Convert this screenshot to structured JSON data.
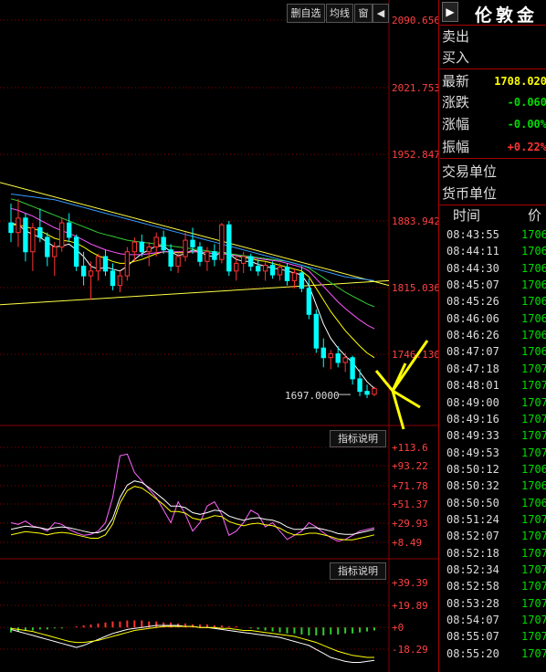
{
  "toolbar": {
    "delete_label": "删自选",
    "ma_label": "均线",
    "window_label": "窗",
    "back_label": "◀"
  },
  "price_axis": [
    "2090.656",
    "2021.753",
    "1952.847",
    "1883.942",
    "1815.036",
    "1746.130"
  ],
  "price_line_label": "1697.0000",
  "indicator1": {
    "button": "指标说明",
    "ticks": [
      "+113.6",
      "+93.22",
      "+71.78",
      "+51.37",
      "+29.93",
      "+8.49"
    ]
  },
  "indicator2": {
    "button": "指标说明",
    "ticks": [
      "+39.39",
      "+19.89",
      "+0",
      "-18.29"
    ]
  },
  "side": {
    "title": "伦敦金",
    "collapse_icon": "▶",
    "sell_label": "卖出",
    "buy_label": "买入",
    "latest_label": "最新",
    "latest_value": "1708.020",
    "change_label": "涨跌",
    "change_value": "-0.060",
    "pct_label": "涨幅",
    "pct_value": "-0.00%",
    "amp_label": "振幅",
    "amp_value": "+0.22%",
    "unit_label": "交易单位",
    "currency_label": "货币单位",
    "time_header": "时间",
    "price_header": "价",
    "ticks": [
      {
        "time": "08:43:55",
        "price": "1706."
      },
      {
        "time": "08:44:11",
        "price": "1706."
      },
      {
        "time": "08:44:30",
        "price": "1706."
      },
      {
        "time": "08:45:07",
        "price": "1706."
      },
      {
        "time": "08:45:26",
        "price": "1706."
      },
      {
        "time": "08:46:06",
        "price": "1706."
      },
      {
        "time": "08:46:26",
        "price": "1706."
      },
      {
        "time": "08:47:07",
        "price": "1706."
      },
      {
        "time": "08:47:18",
        "price": "1707."
      },
      {
        "time": "08:48:01",
        "price": "1707."
      },
      {
        "time": "08:49:00",
        "price": "1707."
      },
      {
        "time": "08:49:16",
        "price": "1707."
      },
      {
        "time": "08:49:33",
        "price": "1707."
      },
      {
        "time": "08:49:53",
        "price": "1707."
      },
      {
        "time": "08:50:12",
        "price": "1706."
      },
      {
        "time": "08:50:32",
        "price": "1706."
      },
      {
        "time": "08:50:50",
        "price": "1706."
      },
      {
        "time": "08:51:24",
        "price": "1707."
      },
      {
        "time": "08:52:07",
        "price": "1707."
      },
      {
        "time": "08:52:18",
        "price": "1707."
      },
      {
        "time": "08:52:34",
        "price": "1707."
      },
      {
        "time": "08:52:58",
        "price": "1707."
      },
      {
        "time": "08:53:28",
        "price": "1707."
      },
      {
        "time": "08:54:07",
        "price": "1707."
      },
      {
        "time": "08:55:07",
        "price": "1707."
      },
      {
        "time": "08:55:20",
        "price": "1707."
      }
    ]
  },
  "colors": {
    "up": "#ff3333",
    "down": "#00ffff",
    "grid": "#8a0000",
    "axis_text": "#ff4040",
    "accent": "#ffff00"
  },
  "chart_data": {
    "type": "candlestick",
    "candles": [
      [
        1880,
        1900,
        1860,
        1870
      ],
      [
        1870,
        1905,
        1855,
        1885
      ],
      [
        1885,
        1890,
        1840,
        1850
      ],
      [
        1850,
        1880,
        1830,
        1875
      ],
      [
        1875,
        1895,
        1860,
        1865
      ],
      [
        1865,
        1870,
        1835,
        1845
      ],
      [
        1845,
        1860,
        1825,
        1855
      ],
      [
        1855,
        1885,
        1850,
        1880
      ],
      [
        1880,
        1890,
        1860,
        1865
      ],
      [
        1865,
        1868,
        1830,
        1835
      ],
      [
        1835,
        1850,
        1815,
        1825
      ],
      [
        1825,
        1840,
        1800,
        1830
      ],
      [
        1830,
        1848,
        1820,
        1845
      ],
      [
        1845,
        1852,
        1825,
        1830
      ],
      [
        1830,
        1838,
        1810,
        1815
      ],
      [
        1815,
        1830,
        1808,
        1825
      ],
      [
        1825,
        1855,
        1820,
        1850
      ],
      [
        1850,
        1865,
        1840,
        1860
      ],
      [
        1860,
        1868,
        1845,
        1850
      ],
      [
        1850,
        1860,
        1835,
        1855
      ],
      [
        1855,
        1870,
        1845,
        1865
      ],
      [
        1865,
        1872,
        1848,
        1852
      ],
      [
        1852,
        1858,
        1830,
        1835
      ],
      [
        1835,
        1848,
        1828,
        1845
      ],
      [
        1845,
        1870,
        1840,
        1862
      ],
      [
        1862,
        1875,
        1848,
        1855
      ],
      [
        1855,
        1860,
        1835,
        1840
      ],
      [
        1840,
        1855,
        1830,
        1850
      ],
      [
        1850,
        1858,
        1835,
        1842
      ],
      [
        1842,
        1880,
        1838,
        1878
      ],
      [
        1878,
        1882,
        1825,
        1830
      ],
      [
        1830,
        1845,
        1820,
        1838
      ],
      [
        1838,
        1850,
        1828,
        1845
      ],
      [
        1845,
        1848,
        1830,
        1835
      ],
      [
        1835,
        1842,
        1825,
        1830
      ],
      [
        1830,
        1840,
        1820,
        1836
      ],
      [
        1836,
        1840,
        1822,
        1826
      ],
      [
        1826,
        1838,
        1820,
        1834
      ],
      [
        1834,
        1838,
        1815,
        1820
      ],
      [
        1820,
        1832,
        1812,
        1828
      ],
      [
        1828,
        1835,
        1808,
        1812
      ],
      [
        1812,
        1822,
        1780,
        1785
      ],
      [
        1785,
        1790,
        1745,
        1750
      ],
      [
        1750,
        1760,
        1730,
        1740
      ],
      [
        1740,
        1748,
        1728,
        1744
      ],
      [
        1744,
        1752,
        1730,
        1735
      ],
      [
        1735,
        1745,
        1725,
        1740
      ],
      [
        1740,
        1742,
        1712,
        1718
      ],
      [
        1718,
        1728,
        1700,
        1705
      ],
      [
        1705,
        1712,
        1698,
        1702
      ],
      [
        1702,
        1710,
        1700,
        1708
      ]
    ],
    "ma_series": [
      {
        "color": "#ffffff",
        "values": [
          1880,
          1878,
          1872,
          1868,
          1865,
          1860,
          1855,
          1856,
          1858,
          1852,
          1845,
          1835,
          1832,
          1834,
          1832,
          1830,
          1835,
          1842,
          1848,
          1852,
          1856,
          1856,
          1850,
          1846,
          1848,
          1852,
          1850,
          1846,
          1845,
          1850,
          1848,
          1842,
          1840,
          1840,
          1837,
          1835,
          1833,
          1832,
          1830,
          1828,
          1826,
          1815,
          1795,
          1775,
          1760,
          1750,
          1742,
          1735,
          1725,
          1715,
          1708
        ]
      },
      {
        "color": "#ffff00",
        "values": [
          1878,
          1878,
          1876,
          1874,
          1872,
          1868,
          1864,
          1862,
          1861,
          1859,
          1855,
          1850,
          1846,
          1843,
          1840,
          1838,
          1838,
          1840,
          1842,
          1845,
          1848,
          1850,
          1850,
          1849,
          1849,
          1850,
          1850,
          1849,
          1848,
          1848,
          1848,
          1846,
          1844,
          1843,
          1841,
          1840,
          1838,
          1836,
          1834,
          1832,
          1830,
          1824,
          1812,
          1800,
          1788,
          1778,
          1768,
          1760,
          1752,
          1745,
          1740
        ]
      },
      {
        "color": "#ff55ff",
        "values": [
          1895,
          1893,
          1890,
          1887,
          1883,
          1879,
          1875,
          1872,
          1869,
          1866,
          1862,
          1858,
          1855,
          1852,
          1850,
          1848,
          1847,
          1847,
          1847,
          1848,
          1849,
          1850,
          1850,
          1850,
          1850,
          1850,
          1850,
          1849,
          1848,
          1848,
          1847,
          1846,
          1845,
          1844,
          1843,
          1842,
          1841,
          1840,
          1838,
          1836,
          1834,
          1830,
          1822,
          1814,
          1806,
          1798,
          1791,
          1785,
          1779,
          1774,
          1770
        ]
      },
      {
        "color": "#33cc33",
        "values": [
          1905,
          1903,
          1900,
          1897,
          1894,
          1891,
          1888,
          1885,
          1882,
          1879,
          1876,
          1873,
          1870,
          1868,
          1866,
          1864,
          1862,
          1861,
          1860,
          1859,
          1858,
          1857,
          1856,
          1855,
          1854,
          1853,
          1852,
          1851,
          1850,
          1849,
          1848,
          1847,
          1846,
          1845,
          1844,
          1843,
          1842,
          1841,
          1840,
          1838,
          1836,
          1833,
          1828,
          1823,
          1818,
          1813,
          1808,
          1804,
          1800,
          1796,
          1793
        ]
      },
      {
        "color": "#3399ff",
        "values": [
          1910,
          1909,
          1908,
          1907,
          1906,
          1905,
          1904,
          1902,
          1900,
          1898,
          1896,
          1894,
          1892,
          1890,
          1888,
          1886,
          1884,
          1882,
          1880,
          1878,
          1876,
          1874,
          1872,
          1870,
          1868,
          1866,
          1864,
          1862,
          1860,
          1858,
          1856,
          1854,
          1852,
          1850,
          1848,
          1846,
          1844,
          1842,
          1840,
          1838,
          1836,
          1834,
          1832,
          1830,
          1828,
          1826,
          1824,
          1823,
          1822,
          1821,
          1820
        ]
      }
    ],
    "trend_lines": [
      {
        "color": "#ffff44",
        "from": [
          0,
          1922
        ],
        "to": [
          50,
          1815
        ]
      },
      {
        "color": "#ffff44",
        "from": [
          0,
          1795
        ],
        "to": [
          50,
          1820
        ]
      }
    ],
    "indicator1": {
      "fast": [
        30,
        28,
        32,
        26,
        24,
        20,
        30,
        28,
        22,
        18,
        15,
        16,
        20,
        30,
        60,
        110,
        112,
        90,
        80,
        70,
        60,
        45,
        30,
        55,
        40,
        20,
        30,
        50,
        55,
        40,
        15,
        20,
        30,
        45,
        40,
        25,
        30,
        20,
        10,
        15,
        20,
        30,
        25,
        18,
        12,
        8,
        10,
        15,
        20,
        22,
        24
      ],
      "slow": [
        22,
        24,
        26,
        25,
        24,
        22,
        24,
        25,
        24,
        22,
        20,
        18,
        18,
        22,
        35,
        60,
        75,
        80,
        78,
        72,
        65,
        58,
        50,
        50,
        48,
        42,
        40,
        42,
        45,
        44,
        38,
        35,
        33,
        35,
        36,
        34,
        33,
        30,
        25,
        22,
        22,
        24,
        24,
        22,
        20,
        17,
        16,
        16,
        18,
        20,
        22
      ]
    },
    "indicator2": {
      "histogram": [
        -5,
        -4,
        -3,
        -3,
        -2,
        -2,
        -1,
        -1,
        0,
        1,
        2,
        3,
        4,
        5,
        6,
        6,
        7,
        7,
        7,
        6,
        6,
        5,
        5,
        4,
        4,
        3,
        3,
        3,
        2,
        2,
        1,
        1,
        0,
        -1,
        -2,
        -3,
        -4,
        -5,
        -6,
        -6,
        -7,
        -8,
        -8,
        -8,
        -7,
        -7,
        -6,
        -6,
        -5,
        -4,
        -3
      ],
      "dif": [
        -2,
        -4,
        -6,
        -8,
        -10,
        -12,
        -14,
        -16,
        -18,
        -20,
        -18,
        -15,
        -12,
        -9,
        -6,
        -4,
        -2,
        -1,
        0,
        1,
        2,
        2,
        2,
        2,
        1,
        1,
        0,
        0,
        -1,
        -2,
        -3,
        -4,
        -5,
        -6,
        -7,
        -8,
        -9,
        -10,
        -12,
        -14,
        -16,
        -18,
        -22,
        -26,
        -30,
        -32,
        -34,
        -35,
        -35,
        -34,
        -33
      ],
      "dea": [
        -1,
        -2,
        -3,
        -4,
        -6,
        -8,
        -10,
        -12,
        -14,
        -15,
        -15,
        -14,
        -13,
        -11,
        -9,
        -7,
        -5,
        -3,
        -2,
        -1,
        0,
        1,
        1,
        1,
        1,
        1,
        0,
        0,
        0,
        -1,
        -1,
        -2,
        -3,
        -3,
        -4,
        -5,
        -6,
        -7,
        -8,
        -9,
        -11,
        -13,
        -15,
        -18,
        -21,
        -24,
        -26,
        -28,
        -29,
        -30,
        -30
      ]
    },
    "price_range": [
      1680,
      2090.656
    ],
    "ind1_range": [
      0,
      120
    ],
    "ind2_range": [
      -30,
      45
    ]
  }
}
